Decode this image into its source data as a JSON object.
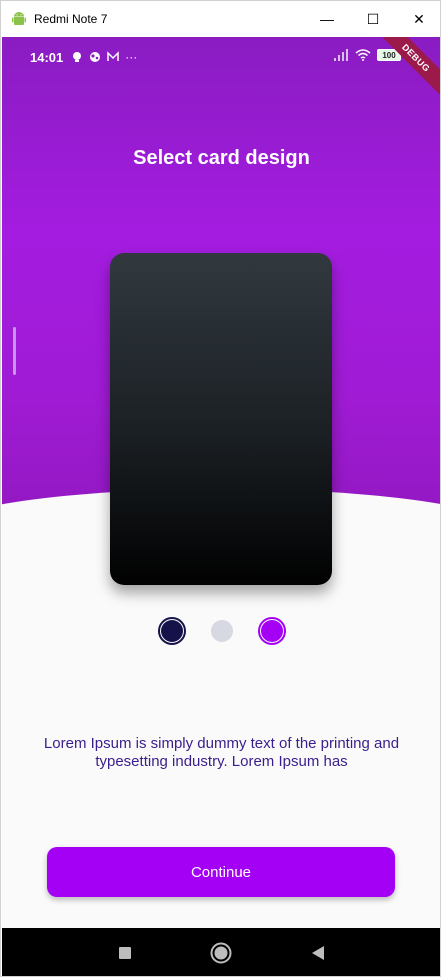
{
  "window": {
    "title": "Redmi Note 7",
    "minimize_glyph": "—",
    "maximize_glyph": "☐",
    "close_glyph": "✕"
  },
  "status_bar": {
    "time": "14:01",
    "battery": "100",
    "debug_label": "DEBUG",
    "more_glyph": "···"
  },
  "screen": {
    "title": "Select card design",
    "description": "Lorem Ipsum is simply dummy text of the printing and typesetting industry. Lorem Ipsum has",
    "continue_label": "Continue"
  },
  "color_options": [
    {
      "name": "navy",
      "color": "#15124a",
      "selected": true
    },
    {
      "name": "light-gray",
      "color": "#d6d8e2",
      "selected": false
    },
    {
      "name": "purple",
      "color": "#a400f6",
      "selected": true
    }
  ],
  "colors": {
    "header_top": "#8a1cc2",
    "header_mid": "#a41ce0",
    "accent": "#a400f6",
    "text_dark_purple": "#3b1e8c",
    "debug_ribbon": "#9b1a4a"
  }
}
